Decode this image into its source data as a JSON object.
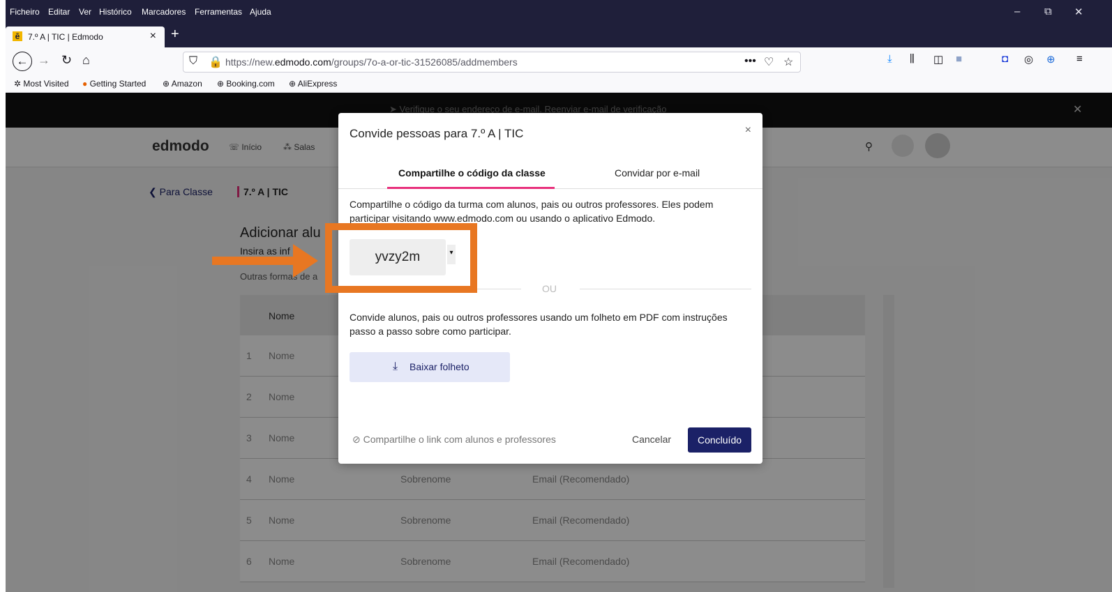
{
  "browser": {
    "menu": [
      "Ficheiro",
      "Editar",
      "Ver",
      "Histórico",
      "Marcadores",
      "Ferramentas",
      "Ajuda"
    ],
    "tab_title": "7.º A | TIC | Edmodo",
    "tab_close": "×",
    "new_tab": "+",
    "url_prefix": "https://new.",
    "url_domain": "edmodo.com",
    "url_path": "/groups/7o-a-or-tic-31526085/addmembers",
    "bookmarks": [
      "Most Visited",
      "Getting Started",
      "Amazon",
      "Booking.com",
      "AliExpress"
    ],
    "window_controls": {
      "minimize": "–",
      "restore": "⧉",
      "close": "✕"
    }
  },
  "banner": {
    "text": "Verifique o seu endereço de e-mail.",
    "link": "Reenviar e-mail de verificação",
    "close": "✕"
  },
  "edmodo_header": {
    "logo": "edmodo",
    "nav": [
      "Início",
      "Salas"
    ]
  },
  "page": {
    "back_link": "Para Classe",
    "class_name": "7.º A | TIC",
    "heading": "Adicionar alu",
    "subheading": "Insira as inf",
    "other_ways": "Outras formas de a",
    "table_header_name": "Nome",
    "rows": [
      {
        "num": "1",
        "name": "Nome",
        "surname": "",
        "email": ""
      },
      {
        "num": "2",
        "name": "Nome",
        "surname": "",
        "email": ""
      },
      {
        "num": "3",
        "name": "Nome",
        "surname": "",
        "email": ""
      },
      {
        "num": "4",
        "name": "Nome",
        "surname": "Sobrenome",
        "email": "Email (Recomendado)"
      },
      {
        "num": "5",
        "name": "Nome",
        "surname": "Sobrenome",
        "email": "Email (Recomendado)"
      },
      {
        "num": "6",
        "name": "Nome",
        "surname": "Sobrenome",
        "email": "Email (Recomendado)"
      }
    ]
  },
  "modal": {
    "title": "Convide pessoas para 7.º A | TIC",
    "close": "×",
    "tabs": [
      "Compartilhe o código da classe",
      "Convidar por e-mail"
    ],
    "intro": "Compartilhe o código da turma com alunos, pais ou outros professores. Eles podem participar visitando www.edmodo.com ou usando o aplicativo Edmodo.",
    "class_code": "yvzy2m",
    "or_text": "OU",
    "pdf_text": "Convide alunos, pais ou outros professores usando um folheto em PDF com instruções passo a passo sobre como participar.",
    "download_label": "Baixar folheto",
    "share_link": "Compartilhe o link com alunos e professores",
    "cancel": "Cancelar",
    "done": "Concluído"
  },
  "colors": {
    "accent_pink": "#e8307c",
    "button_navy": "#1b2167",
    "annotation_orange": "#e87722"
  }
}
